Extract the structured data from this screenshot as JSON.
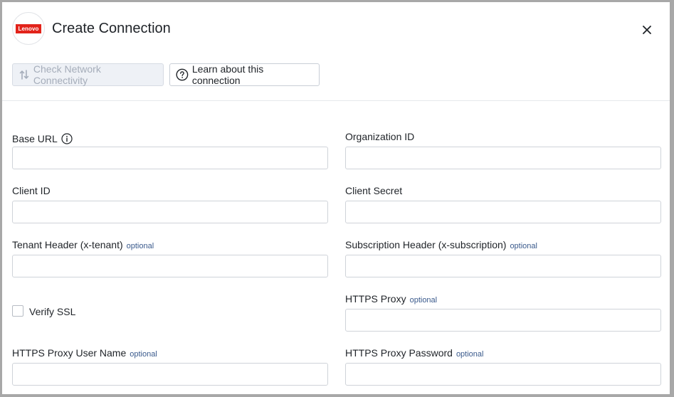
{
  "dialog": {
    "logo_text": "Lenovo",
    "title": "Create Connection",
    "close_icon": "close-icon"
  },
  "toolbar": {
    "check_label": "Check Network Connectivity",
    "check_icon": "network-arrows-icon",
    "learn_label": "Learn about this connection",
    "learn_icon": "help-circle-icon"
  },
  "form": {
    "optional_tag": "optional",
    "fields": {
      "base_url": {
        "label": "Base URL",
        "value": "",
        "icon": "info-icon"
      },
      "organization_id": {
        "label": "Organization ID",
        "value": ""
      },
      "client_id": {
        "label": "Client ID",
        "value": ""
      },
      "client_secret": {
        "label": "Client Secret",
        "value": ""
      },
      "tenant_header": {
        "label": "Tenant Header (x-tenant)",
        "value": ""
      },
      "subscription_header": {
        "label": "Subscription Header (x-subscription)",
        "value": ""
      },
      "verify_ssl": {
        "label": "Verify SSL",
        "checked": false
      },
      "https_proxy": {
        "label": "HTTPS Proxy",
        "value": ""
      },
      "https_proxy_user": {
        "label": "HTTPS Proxy User Name",
        "value": ""
      },
      "https_proxy_password": {
        "label": "HTTPS Proxy Password",
        "value": ""
      }
    }
  },
  "colors": {
    "brand": "#e2231a",
    "optional_text": "#3a5a8c",
    "disabled_text": "#a5adba",
    "input_border": "#cfd3d9"
  }
}
